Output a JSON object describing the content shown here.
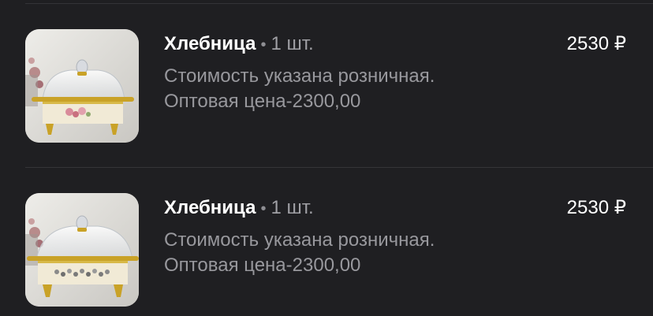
{
  "items": [
    {
      "title": "Хлебница",
      "separator": "•",
      "quantity": "1 шт.",
      "desc_line1": "Стоимость указана розничная.",
      "desc_line2": "Оптовая цена-2300,00",
      "price": "2530 ₽"
    },
    {
      "title": "Хлебница",
      "separator": "•",
      "quantity": "1 шт.",
      "desc_line1": "Стоимость указана розничная.",
      "desc_line2": "Оптовая цена-2300,00",
      "price": "2530 ₽"
    }
  ],
  "colors": {
    "background": "#1f1f22",
    "title": "#ffffff",
    "secondary": "#98989d",
    "divider": "#343438",
    "gold": "#c9a227"
  }
}
